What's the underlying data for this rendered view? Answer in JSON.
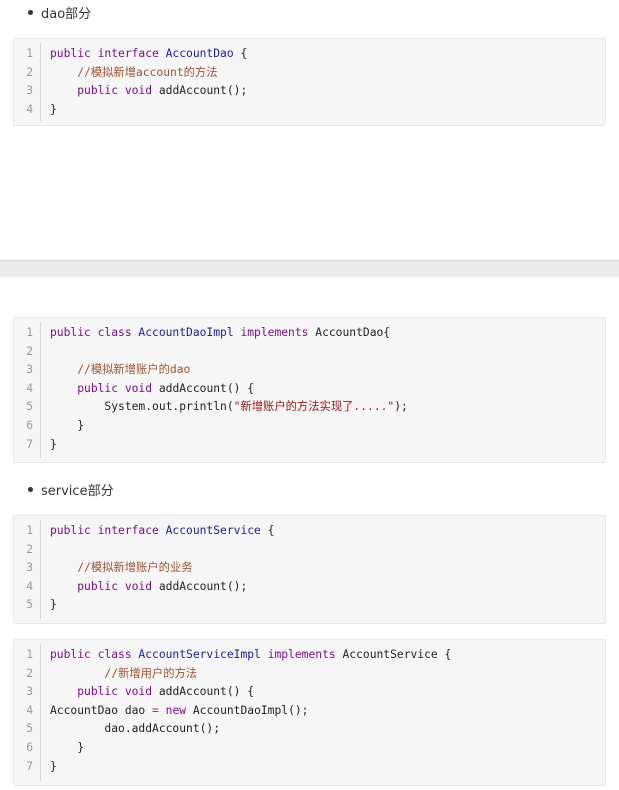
{
  "sections": {
    "dao_heading": "dao部分",
    "service_heading": "service部分"
  },
  "blocks": [
    {
      "lines": [
        {
          "n": "1",
          "segs": [
            [
              "kw",
              "public "
            ],
            [
              "kw",
              "interface "
            ],
            [
              "ty",
              "AccountDao"
            ],
            [
              "pl",
              " {"
            ]
          ]
        },
        {
          "n": "2",
          "segs": [
            [
              "pl",
              "    "
            ],
            [
              "cm",
              "//模拟新增account的方法"
            ]
          ]
        },
        {
          "n": "3",
          "segs": [
            [
              "pl",
              "    "
            ],
            [
              "kw",
              "public "
            ],
            [
              "kw",
              "void "
            ],
            [
              "pl",
              "addAccount();"
            ]
          ]
        },
        {
          "n": "4",
          "segs": [
            [
              "pl",
              "}"
            ]
          ]
        }
      ]
    },
    {
      "lines": [
        {
          "n": "1",
          "segs": [
            [
              "kw",
              "public "
            ],
            [
              "kw",
              "class "
            ],
            [
              "ty",
              "AccountDaoImpl "
            ],
            [
              "kw",
              "implements "
            ],
            [
              "pl",
              "AccountDao{"
            ]
          ]
        },
        {
          "n": "2",
          "segs": [
            [
              "pl",
              ""
            ]
          ]
        },
        {
          "n": "3",
          "segs": [
            [
              "pl",
              "    "
            ],
            [
              "cm",
              "//模拟新增账户的dao"
            ]
          ]
        },
        {
          "n": "4",
          "segs": [
            [
              "pl",
              "    "
            ],
            [
              "kw",
              "public "
            ],
            [
              "kw",
              "void "
            ],
            [
              "pl",
              "addAccount() {"
            ]
          ]
        },
        {
          "n": "5",
          "segs": [
            [
              "pl",
              "        System.out.println("
            ],
            [
              "st",
              "\"新增账户的方法实现了.....\""
            ],
            [
              "pl",
              ");"
            ]
          ]
        },
        {
          "n": "6",
          "segs": [
            [
              "pl",
              "    }"
            ]
          ]
        },
        {
          "n": "7",
          "segs": [
            [
              "pl",
              "}"
            ]
          ]
        }
      ]
    },
    {
      "lines": [
        {
          "n": "1",
          "segs": [
            [
              "kw",
              "public "
            ],
            [
              "kw",
              "interface "
            ],
            [
              "ty",
              "AccountService"
            ],
            [
              "pl",
              " {"
            ]
          ]
        },
        {
          "n": "2",
          "segs": [
            [
              "pl",
              ""
            ]
          ]
        },
        {
          "n": "3",
          "segs": [
            [
              "pl",
              "    "
            ],
            [
              "cm",
              "//模拟新增账户的业务"
            ]
          ]
        },
        {
          "n": "4",
          "segs": [
            [
              "pl",
              "    "
            ],
            [
              "kw",
              "public "
            ],
            [
              "kw",
              "void "
            ],
            [
              "pl",
              "addAccount();"
            ]
          ]
        },
        {
          "n": "5",
          "segs": [
            [
              "pl",
              "}"
            ]
          ]
        }
      ]
    },
    {
      "lines": [
        {
          "n": "1",
          "segs": [
            [
              "kw",
              "public "
            ],
            [
              "kw",
              "class "
            ],
            [
              "ty",
              "AccountServiceImpl "
            ],
            [
              "kw",
              "implements "
            ],
            [
              "pl",
              "AccountService {"
            ]
          ]
        },
        {
          "n": "2",
          "segs": [
            [
              "pl",
              "        "
            ],
            [
              "cm",
              "//新增用户的方法"
            ]
          ]
        },
        {
          "n": "3",
          "segs": [
            [
              "pl",
              "    "
            ],
            [
              "kw",
              "public "
            ],
            [
              "kw",
              "void "
            ],
            [
              "pl",
              "addAccount() {"
            ]
          ]
        },
        {
          "n": "4",
          "segs": [
            [
              "pl",
              "AccountDao dao "
            ],
            [
              "op",
              "= "
            ],
            [
              "kw",
              "new "
            ],
            [
              "pl",
              "AccountDaoImpl();"
            ]
          ]
        },
        {
          "n": "5",
          "segs": [
            [
              "pl",
              "        dao.addAccount();"
            ]
          ]
        },
        {
          "n": "6",
          "segs": [
            [
              "pl",
              "    }"
            ]
          ]
        },
        {
          "n": "7",
          "segs": [
            [
              "pl",
              "}"
            ]
          ]
        }
      ]
    }
  ]
}
